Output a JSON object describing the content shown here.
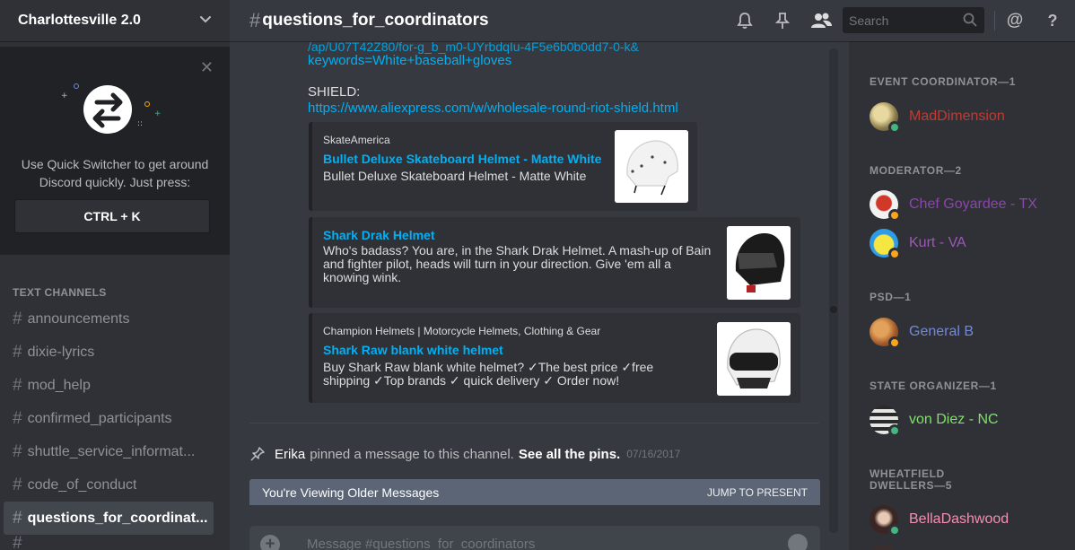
{
  "server": {
    "name": "Charlottesville 2.0"
  },
  "quick_switcher": {
    "text": "Use Quick Switcher to get around Discord quickly. Just press:",
    "shortcut": "CTRL + K"
  },
  "sidebar": {
    "section_label": "TEXT CHANNELS",
    "channels": [
      {
        "name": "announcements"
      },
      {
        "name": "dixie-lyrics"
      },
      {
        "name": "mod_help"
      },
      {
        "name": "confirmed_participants"
      },
      {
        "name": "shuttle_service_informat..."
      },
      {
        "name": "code_of_conduct"
      },
      {
        "name": "questions_for_coordinat...",
        "active": true
      }
    ]
  },
  "header": {
    "channel_name": "questions_for_coordinators",
    "search_placeholder": "Search"
  },
  "messages": {
    "partial_line_1": "/ap/U07T42Z80/for-g_b_m0-UYrbdqIu-4F5e6b0b0dd7-0-k&",
    "partial_line_2": "keywords=White+baseball+gloves",
    "shield_label": "SHIELD:",
    "shield_url": "https://www.aliexpress.com/w/wholesale-round-riot-shield.html",
    "embeds": [
      {
        "provider": "SkateAmerica",
        "title": "Bullet Deluxe Skateboard Helmet - Matte White",
        "description": "Bullet Deluxe Skateboard Helmet - Matte White"
      },
      {
        "provider": "",
        "title": "Shark Drak Helmet",
        "description": "Who's badass? You are, in the Shark Drak Helmet. A mash-up of Bain and fighter pilot, heads will turn in your direction. Give 'em all a knowing wink."
      },
      {
        "provider": "Champion Helmets | Motorcycle Helmets, Clothing & Gear",
        "title": "Shark Raw blank white helmet",
        "description": "Buy Shark Raw blank white helmet? ✓The best price ✓free shipping ✓Top brands ✓ quick delivery ✓ Order now!"
      }
    ],
    "pin_notice": {
      "actor": "Erika",
      "text": "pinned a message to this channel.",
      "link": "See all the pins.",
      "timestamp": "07/16/2017"
    },
    "older_banner": "You're Viewing Older Messages",
    "jump_label": "JUMP TO PRESENT",
    "composer_placeholder": "Message #questions_for_coordinators"
  },
  "members": {
    "groups": [
      {
        "role": "EVENT COORDINATOR—1",
        "members": [
          {
            "name": "MadDimension",
            "color": "#c03b34",
            "status": "online"
          }
        ]
      },
      {
        "role": "MODERATOR—2",
        "members": [
          {
            "name": "Chef Goyardee - TX",
            "color": "#8e44ad",
            "status": "idle"
          },
          {
            "name": "Kurt - VA",
            "color": "#9b59b6",
            "status": "idle"
          }
        ]
      },
      {
        "role": "PSD—1",
        "members": [
          {
            "name": "General B",
            "color": "#7289da",
            "status": "idle"
          }
        ]
      },
      {
        "role": "STATE ORGANIZER—1",
        "members": [
          {
            "name": "von Diez - NC",
            "color": "#80e06a",
            "status": "online"
          }
        ]
      },
      {
        "role": "WHEATFIELD DWELLERS—5",
        "members": [
          {
            "name": "BellaDashwood",
            "color": "#f48fb1",
            "status": "online"
          }
        ]
      }
    ]
  },
  "colors": {
    "link": "#00b0f4",
    "online": "#43b581",
    "idle": "#faa61a"
  }
}
